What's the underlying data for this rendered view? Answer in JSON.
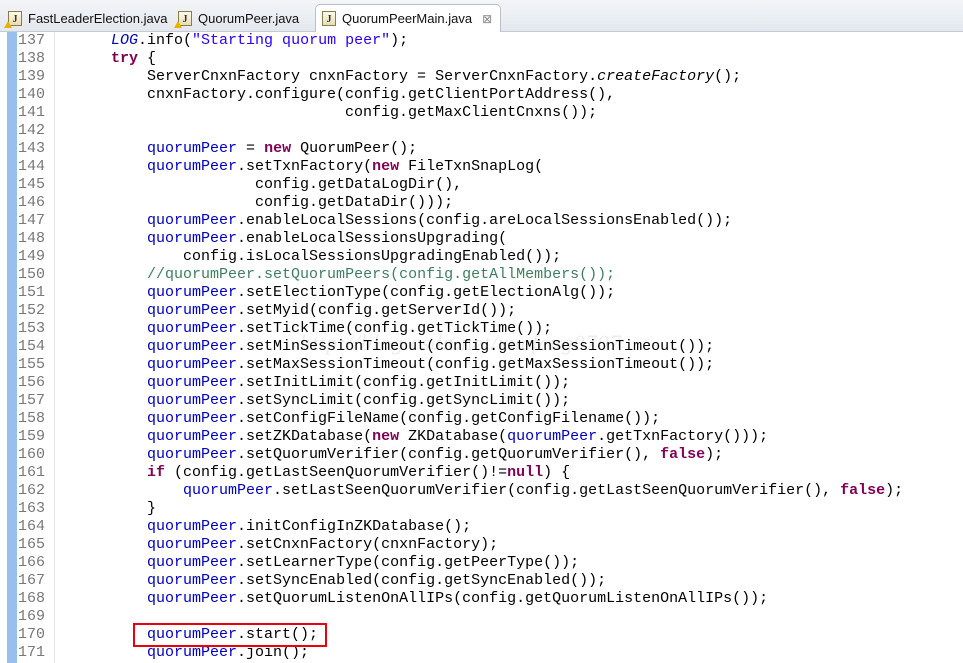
{
  "tabs": [
    {
      "label": "FastLeaderElection.java",
      "icon": "java-file-warning-icon",
      "active": false
    },
    {
      "label": "QuorumPeer.java",
      "icon": "java-file-warning-icon",
      "active": false
    },
    {
      "label": "QuorumPeerMain.java",
      "icon": "java-file-icon",
      "active": true,
      "close": "⊠"
    }
  ],
  "watermark": "http://blog.csdn.net/xuefeng0707",
  "highlight_color": "#e8000e",
  "code": {
    "highlighted_line": "170",
    "lines": [
      {
        "num": "137",
        "tokens": [
          [
            "t",
            "        "
          ],
          [
            "sf",
            "LOG"
          ],
          [
            "t",
            ".info("
          ],
          [
            "s",
            "\"Starting quorum peer\""
          ],
          [
            "t",
            ");"
          ]
        ]
      },
      {
        "num": "138",
        "tokens": [
          [
            "t",
            "        "
          ],
          [
            "k",
            "try"
          ],
          [
            "t",
            " {"
          ]
        ]
      },
      {
        "num": "139",
        "tokens": [
          [
            "t",
            "            ServerCnxnFactory cnxnFactory = ServerCnxnFactory."
          ],
          [
            "sm",
            "createFactory"
          ],
          [
            "t",
            "();"
          ]
        ]
      },
      {
        "num": "140",
        "tokens": [
          [
            "t",
            "            cnxnFactory.configure(config.getClientPortAddress(),"
          ]
        ]
      },
      {
        "num": "141",
        "tokens": [
          [
            "t",
            "                                  config.getMaxClientCnxns());"
          ]
        ]
      },
      {
        "num": "142",
        "tokens": []
      },
      {
        "num": "143",
        "tokens": [
          [
            "t",
            "            "
          ],
          [
            "f",
            "quorumPeer"
          ],
          [
            "t",
            " = "
          ],
          [
            "k",
            "new"
          ],
          [
            "t",
            " QuorumPeer();"
          ]
        ]
      },
      {
        "num": "144",
        "tokens": [
          [
            "t",
            "            "
          ],
          [
            "f",
            "quorumPeer"
          ],
          [
            "t",
            ".setTxnFactory("
          ],
          [
            "k",
            "new"
          ],
          [
            "t",
            " FileTxnSnapLog("
          ]
        ]
      },
      {
        "num": "145",
        "tokens": [
          [
            "t",
            "                        config.getDataLogDir(),"
          ]
        ]
      },
      {
        "num": "146",
        "tokens": [
          [
            "t",
            "                        config.getDataDir()));"
          ]
        ]
      },
      {
        "num": "147",
        "tokens": [
          [
            "t",
            "            "
          ],
          [
            "f",
            "quorumPeer"
          ],
          [
            "t",
            ".enableLocalSessions(config.areLocalSessionsEnabled());"
          ]
        ]
      },
      {
        "num": "148",
        "tokens": [
          [
            "t",
            "            "
          ],
          [
            "f",
            "quorumPeer"
          ],
          [
            "t",
            ".enableLocalSessionsUpgrading("
          ]
        ]
      },
      {
        "num": "149",
        "tokens": [
          [
            "t",
            "                config.isLocalSessionsUpgradingEnabled());"
          ]
        ]
      },
      {
        "num": "150",
        "tokens": [
          [
            "t",
            "            "
          ],
          [
            "c",
            "//quorumPeer.setQuorumPeers(config.getAllMembers());"
          ]
        ]
      },
      {
        "num": "151",
        "tokens": [
          [
            "t",
            "            "
          ],
          [
            "f",
            "quorumPeer"
          ],
          [
            "t",
            ".setElectionType(config.getElectionAlg());"
          ]
        ]
      },
      {
        "num": "152",
        "tokens": [
          [
            "t",
            "            "
          ],
          [
            "f",
            "quorumPeer"
          ],
          [
            "t",
            ".setMyid(config.getServerId());"
          ]
        ]
      },
      {
        "num": "153",
        "tokens": [
          [
            "t",
            "            "
          ],
          [
            "f",
            "quorumPeer"
          ],
          [
            "t",
            ".setTickTime(config.getTickTime());"
          ]
        ]
      },
      {
        "num": "154",
        "tokens": [
          [
            "t",
            "            "
          ],
          [
            "f",
            "quorumPeer"
          ],
          [
            "t",
            ".setMinSessionTimeout(config.getMinSessionTimeout());"
          ]
        ]
      },
      {
        "num": "155",
        "tokens": [
          [
            "t",
            "            "
          ],
          [
            "f",
            "quorumPeer"
          ],
          [
            "t",
            ".setMaxSessionTimeout(config.getMaxSessionTimeout());"
          ]
        ]
      },
      {
        "num": "156",
        "tokens": [
          [
            "t",
            "            "
          ],
          [
            "f",
            "quorumPeer"
          ],
          [
            "t",
            ".setInitLimit(config.getInitLimit());"
          ]
        ]
      },
      {
        "num": "157",
        "tokens": [
          [
            "t",
            "            "
          ],
          [
            "f",
            "quorumPeer"
          ],
          [
            "t",
            ".setSyncLimit(config.getSyncLimit());"
          ]
        ]
      },
      {
        "num": "158",
        "tokens": [
          [
            "t",
            "            "
          ],
          [
            "f",
            "quorumPeer"
          ],
          [
            "t",
            ".setConfigFileName(config.getConfigFilename());"
          ]
        ]
      },
      {
        "num": "159",
        "tokens": [
          [
            "t",
            "            "
          ],
          [
            "f",
            "quorumPeer"
          ],
          [
            "t",
            ".setZKDatabase("
          ],
          [
            "k",
            "new"
          ],
          [
            "t",
            " ZKDatabase("
          ],
          [
            "f",
            "quorumPeer"
          ],
          [
            "t",
            ".getTxnFactory()));"
          ]
        ]
      },
      {
        "num": "160",
        "tokens": [
          [
            "t",
            "            "
          ],
          [
            "f",
            "quorumPeer"
          ],
          [
            "t",
            ".setQuorumVerifier(config.getQuorumVerifier(), "
          ],
          [
            "k",
            "false"
          ],
          [
            "t",
            ");"
          ]
        ]
      },
      {
        "num": "161",
        "tokens": [
          [
            "t",
            "            "
          ],
          [
            "k",
            "if"
          ],
          [
            "t",
            " (config.getLastSeenQuorumVerifier()!="
          ],
          [
            "k",
            "null"
          ],
          [
            "t",
            ") {"
          ]
        ]
      },
      {
        "num": "162",
        "tokens": [
          [
            "t",
            "                "
          ],
          [
            "f",
            "quorumPeer"
          ],
          [
            "t",
            ".setLastSeenQuorumVerifier(config.getLastSeenQuorumVerifier(), "
          ],
          [
            "k",
            "false"
          ],
          [
            "t",
            ");"
          ]
        ]
      },
      {
        "num": "163",
        "tokens": [
          [
            "t",
            "            }"
          ]
        ]
      },
      {
        "num": "164",
        "tokens": [
          [
            "t",
            "            "
          ],
          [
            "f",
            "quorumPeer"
          ],
          [
            "t",
            ".initConfigInZKDatabase();"
          ]
        ]
      },
      {
        "num": "165",
        "tokens": [
          [
            "t",
            "            "
          ],
          [
            "f",
            "quorumPeer"
          ],
          [
            "t",
            ".setCnxnFactory(cnxnFactory);"
          ]
        ]
      },
      {
        "num": "166",
        "tokens": [
          [
            "t",
            "            "
          ],
          [
            "f",
            "quorumPeer"
          ],
          [
            "t",
            ".setLearnerType(config.getPeerType());"
          ]
        ]
      },
      {
        "num": "167",
        "tokens": [
          [
            "t",
            "            "
          ],
          [
            "f",
            "quorumPeer"
          ],
          [
            "t",
            ".setSyncEnabled(config.getSyncEnabled());"
          ]
        ]
      },
      {
        "num": "168",
        "tokens": [
          [
            "t",
            "            "
          ],
          [
            "f",
            "quorumPeer"
          ],
          [
            "t",
            ".setQuorumListenOnAllIPs(config.getQuorumListenOnAllIPs());"
          ]
        ]
      },
      {
        "num": "169",
        "tokens": []
      },
      {
        "num": "170",
        "tokens": [
          [
            "t",
            "            "
          ],
          [
            "f",
            "quorumPeer"
          ],
          [
            "t",
            ".start();"
          ]
        ]
      },
      {
        "num": "171",
        "tokens": [
          [
            "t",
            "            "
          ],
          [
            "f",
            "quorumPeer"
          ],
          [
            "t",
            ".join();"
          ]
        ]
      }
    ]
  }
}
